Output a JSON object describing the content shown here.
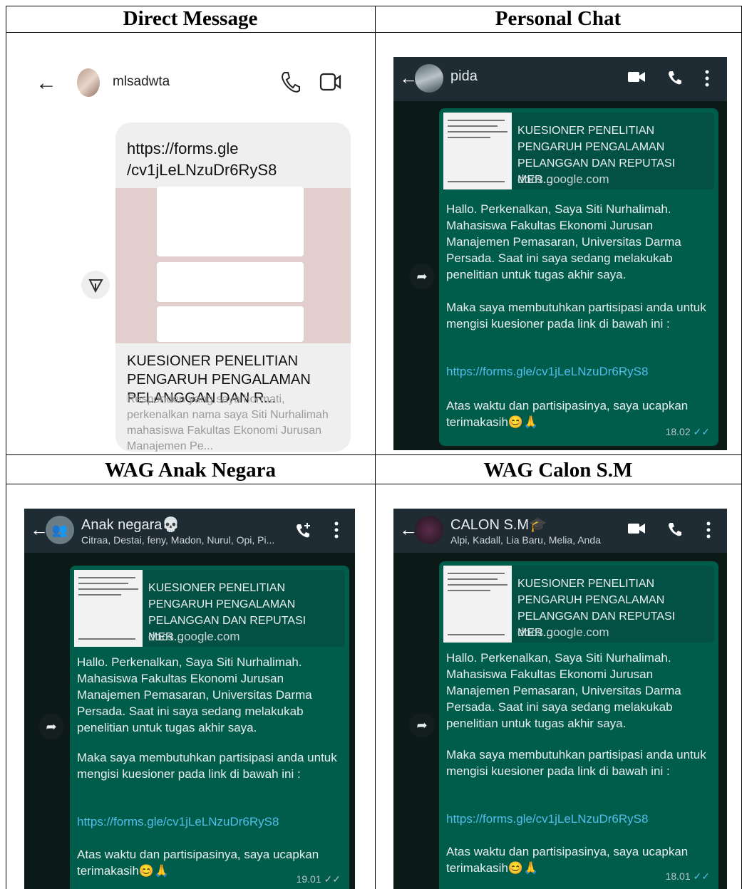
{
  "headers": {
    "top_left": "Direct Message",
    "top_right": "Personal Chat",
    "bottom_left": "WAG Anak Negara",
    "bottom_right": "WAG Calon S.M"
  },
  "dm": {
    "username": "mlsadwta",
    "url": "https://forms.gle /cv1jLeLNzuDr6RyS8",
    "card_title": "KUESIONER PENELITIAN PENGARUH PENGALAMAN PELANGGAN DAN R...",
    "card_desc": "Responden yang saya hormati, perkenalkan nama saya Siti Nurhalimah mahasiswa Fakultas Ekonomi Jurusan Manajemen Pe..."
  },
  "link_preview": {
    "title": "KUESIONER PENELITIAN PENGARUH PENGALAMAN PELANGGAN DAN REPUTASI MER...",
    "domain": "docs.google.com"
  },
  "message": {
    "p1": "Hallo. Perkenalkan, Saya Siti Nurhalimah. Mahasiswa Fakultas Ekonomi Jurusan Manajemen Pemasaran, Universitas Darma Persada. Saat ini saya sedang melakukab penelitian untuk tugas akhir saya.",
    "p2": "Maka saya membutuhkan partisipasi anda untuk mengisi kuesioner pada link di bawah ini :",
    "link": "https://forms.gle/cv1jLeLNzuDr6RyS8",
    "p3": "Atas waktu dan partisipasinya, saya ucapkan terimakasih😊🙏"
  },
  "chats": {
    "personal": {
      "name": "pida",
      "time": "18.02"
    },
    "anak_negara": {
      "name": "Anak negara💀",
      "members": "Citraa, Destai, feny, Madon, Nurul, Opi, Pi...",
      "time": "19.01"
    },
    "calon_sm": {
      "name": "CALON S.M🎓",
      "members": "Alpi, Kadall, Lia Baru, Melia, Anda",
      "time": "18.01"
    }
  },
  "colors": {
    "wa_bg": "#0b1a17",
    "wa_header": "#1f2c33",
    "bubble": "#005c4b",
    "link": "#53bdeb"
  }
}
